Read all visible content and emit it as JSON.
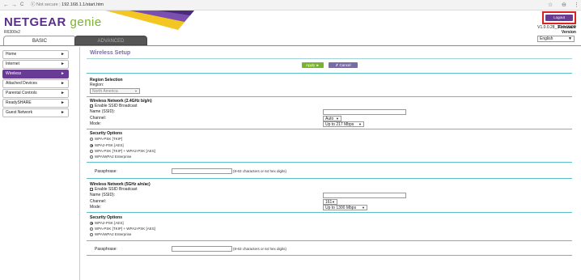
{
  "browser": {
    "back": "←",
    "forward": "→",
    "reload": "C",
    "info": "ⓘ",
    "not_secure": "Not secure",
    "url": "192.168.1.1/start.htm",
    "star": "☆",
    "account": "⊖",
    "menu": "⋮"
  },
  "header": {
    "brand": "NETGEAR",
    "genie": "genie",
    "model": "R6300v2",
    "logout": "Logout",
    "fw_label": "Firmware Version",
    "fw_version": "V1.0.0.28_10.0.15CP",
    "language": "English"
  },
  "tabs": {
    "basic": "BASIC",
    "advanced": "ADVANCED"
  },
  "sidebar": {
    "items": [
      {
        "label": "Home"
      },
      {
        "label": "Internet"
      },
      {
        "label": "Wireless"
      },
      {
        "label": "Attached Devices"
      },
      {
        "label": "Parental Controls"
      },
      {
        "label": "ReadySHARE"
      },
      {
        "label": "Guest Network"
      }
    ]
  },
  "main": {
    "title": "Wireless Setup",
    "apply": "Apply ►",
    "cancel": "✗ Cancel",
    "region_heading": "Region Selection",
    "region_label": "Region:",
    "region_value": "North America",
    "wn24": {
      "heading": "Wireless Network (2.4GHz b/g/n)",
      "ssid_broadcast": "Enable SSID Broadcast",
      "name_label": "Name (SSID):",
      "channel_label": "Channel:",
      "channel_value": "Auto",
      "mode_label": "Mode:",
      "mode_value": "Up to 217 Mbps"
    },
    "sec1": {
      "heading": "Security Options",
      "options": [
        "WPA-PSK [TKIP]",
        "WPA2-PSK [AES]",
        "WPA-PSK [TKIP] + WPA2-PSK [AES]",
        "WPA/WPA2 Enterprise"
      ],
      "passphrase_label": "Passphrase:",
      "passphrase_hint": "(8-63 characters or 64 hex digits)"
    },
    "wn5": {
      "heading": "Wireless Network (5GHz a/n/ac)",
      "ssid_broadcast": "Enable SSID Broadcast",
      "name_label": "Name (SSID):",
      "channel_label": "Channel:",
      "channel_value": "161",
      "mode_label": "Mode:",
      "mode_value": "Up to 1300 Mbps"
    },
    "sec2": {
      "heading": "Security Options",
      "options": [
        "WPA2-PSK [AES]",
        "WPA-PSK [TKIP] + WPA2-PSK [AES]",
        "WPA/WPA2 Enterprise"
      ],
      "passphrase_label": "Passphrase:",
      "passphrase_hint": "(8-63 characters or 64 hex digits)"
    }
  },
  "colors": {
    "brand_purple": "#6a3b95",
    "genie_green": "#7ab32e",
    "teal_rule": "#5bbfc8"
  }
}
